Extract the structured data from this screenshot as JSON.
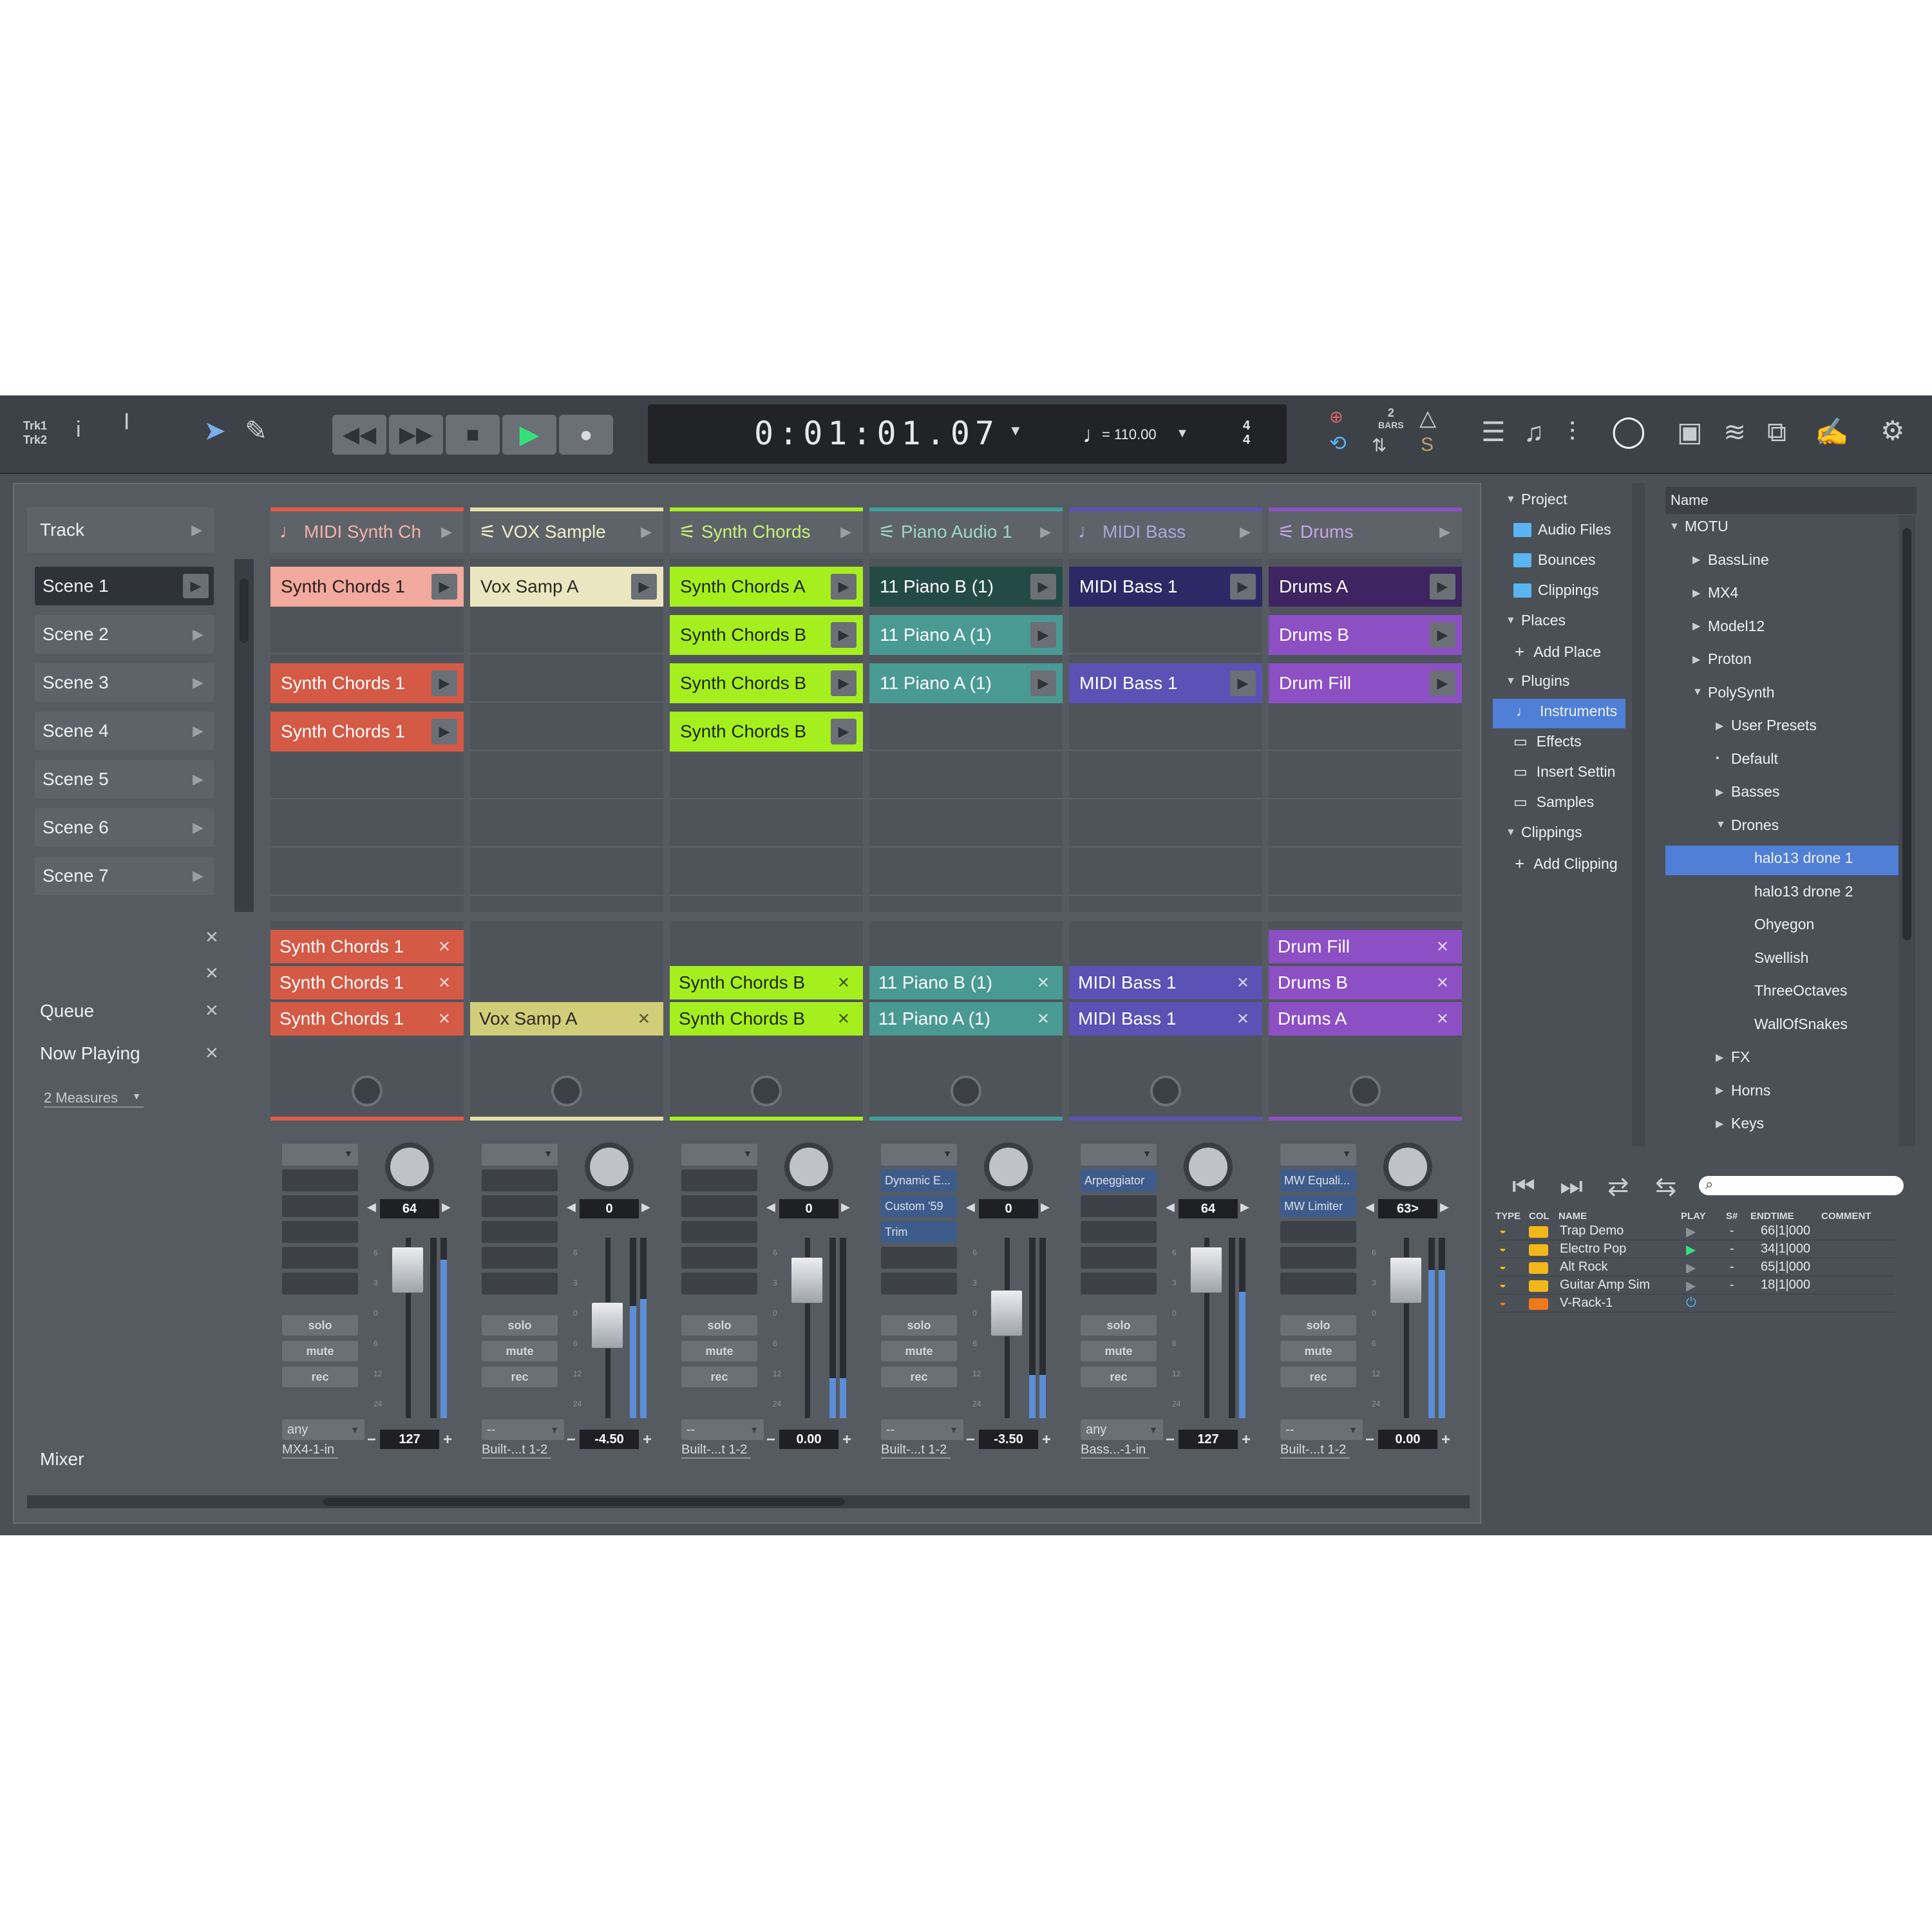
{
  "toolbar": {
    "trk_label": "Trk1\nTrk2",
    "counter_time": "0:01:01.07",
    "tempo": "110.00",
    "meter_top": "4",
    "meter_bottom": "4",
    "bars_count": "2",
    "bars_label": "BARS"
  },
  "sidebar": {
    "track_label": "Track",
    "scenes": [
      "Scene 1",
      "Scene 2",
      "Scene 3",
      "Scene 4",
      "Scene 5",
      "Scene 6",
      "Scene 7"
    ],
    "queue_label": "Queue",
    "now_playing_label": "Now Playing",
    "measures": "2 Measures",
    "mixer_label": "Mixer"
  },
  "tracks": [
    {
      "name": "MIDI Synth Ch",
      "color": "#e35a48",
      "header_text_color": "#f5b3a6",
      "icon": "♩",
      "clips": [
        {
          "row": 0,
          "label": "Synth Chords 1",
          "bg": "#f2a99e",
          "fg": "#2a1d1b"
        },
        {
          "row": 2,
          "label": "Synth Chords 1",
          "bg": "#d45a46",
          "fg": "#ffffff"
        },
        {
          "row": 3,
          "label": "Synth Chords 1",
          "bg": "#d45a46",
          "fg": "#ffffff"
        }
      ],
      "queue": [
        {
          "row": 0,
          "label": "Synth Chords 1"
        },
        {
          "row": 1,
          "label": "Synth Chords 1"
        },
        {
          "row": 2,
          "label": "Synth Chords 1"
        }
      ],
      "queue_bg": "#d45a46",
      "queue_fg": "#ffffff",
      "mixer": {
        "inserts": [],
        "knob": "64",
        "fader": "127",
        "fader_pos": 0.12,
        "meter_l": 0,
        "meter_r": 0.88,
        "input": "any",
        "output": "MX4-1-in"
      }
    },
    {
      "name": "VOX Sample",
      "color": "#e4e0a4",
      "header_text_color": "#f2efc8",
      "icon": "⚟",
      "clips": [
        {
          "row": 0,
          "label": "Vox Samp A",
          "bg": "#eae7c0",
          "fg": "#2a2a22"
        }
      ],
      "queue": [
        {
          "row": 2,
          "label": "Vox Samp A"
        }
      ],
      "queue_bg": "#d1cd79",
      "queue_fg": "#2a2a22",
      "mixer": {
        "inserts": [],
        "knob": "0",
        "fader": "-4.50",
        "fader_pos": 0.43,
        "meter_l": 0.62,
        "meter_r": 0.66,
        "input": "--",
        "output": "Built-...t 1-2"
      }
    },
    {
      "name": "Synth Chords",
      "color": "#a6ef1f",
      "header_text_color": "#c8f27a",
      "icon": "⚟",
      "clips": [
        {
          "row": 0,
          "label": "Synth Chords A",
          "bg": "#a6ef1f",
          "fg": "#1a2608"
        },
        {
          "row": 1,
          "label": "Synth Chords B",
          "bg": "#a6ef1f",
          "fg": "#1a2608"
        },
        {
          "row": 2,
          "label": "Synth Chords B",
          "bg": "#a6ef1f",
          "fg": "#1a2608"
        },
        {
          "row": 3,
          "label": "Synth Chords B",
          "bg": "#a6ef1f",
          "fg": "#1a2608"
        }
      ],
      "queue": [
        {
          "row": 1,
          "label": "Synth Chords B"
        },
        {
          "row": 2,
          "label": "Synth Chords B"
        }
      ],
      "queue_bg": "#a6ef1f",
      "queue_fg": "#1a2608",
      "mixer": {
        "inserts": [],
        "knob": "0",
        "fader": "0.00",
        "fader_pos": 0.18,
        "meter_l": 0.22,
        "meter_r": 0.22,
        "input": "--",
        "output": "Built-...t 1-2"
      }
    },
    {
      "name": "Piano Audio 1",
      "color": "#3fa09a",
      "header_text_color": "#9fd4d0",
      "icon": "⚟",
      "clips": [
        {
          "row": 0,
          "label": "11 Piano B (1)",
          "bg": "#244a48",
          "fg": "#ffffff"
        },
        {
          "row": 1,
          "label": "11 Piano A (1)",
          "bg": "#4a9a94",
          "fg": "#ffffff"
        },
        {
          "row": 2,
          "label": "11 Piano A (1)",
          "bg": "#4a9a94",
          "fg": "#ffffff"
        }
      ],
      "queue": [
        {
          "row": 1,
          "label": "11 Piano B (1)"
        },
        {
          "row": 2,
          "label": "11 Piano A (1)"
        }
      ],
      "queue_bg": "#4a9a94",
      "queue_fg": "#ffffff",
      "mixer": {
        "inserts": [
          "Dynamic E...",
          "Custom '59",
          "Trim"
        ],
        "knob": "0",
        "fader": "-3.50",
        "fader_pos": 0.36,
        "meter_l": 0.24,
        "meter_r": 0.24,
        "input": "--",
        "output": "Built-...t 1-2"
      }
    },
    {
      "name": "MIDI Bass",
      "color": "#5a52b5",
      "header_text_color": "#aaa6dd",
      "icon": "♩",
      "clips": [
        {
          "row": 0,
          "label": "MIDI Bass 1",
          "bg": "#2c2a66",
          "fg": "#ffffff"
        },
        {
          "row": 2,
          "label": "MIDI Bass 1",
          "bg": "#5a52b5",
          "fg": "#ffffff"
        }
      ],
      "queue": [
        {
          "row": 1,
          "label": "MIDI Bass 1"
        },
        {
          "row": 2,
          "label": "MIDI Bass 1"
        }
      ],
      "queue_bg": "#5a52b5",
      "queue_fg": "#ffffff",
      "mixer": {
        "inserts": [
          "Arpeggiator"
        ],
        "knob": "64",
        "fader": "127",
        "fader_pos": 0.12,
        "meter_l": 0,
        "meter_r": 0.7,
        "input": "any",
        "output": "Bass...-1-in"
      }
    },
    {
      "name": "Drums",
      "color": "#8c4fc4",
      "header_text_color": "#c6a6e6",
      "icon": "⚟",
      "clips": [
        {
          "row": 0,
          "label": "Drums A",
          "bg": "#3e2460",
          "fg": "#ffffff"
        },
        {
          "row": 1,
          "label": "Drums B",
          "bg": "#8c4fc4",
          "fg": "#ffffff"
        },
        {
          "row": 2,
          "label": "Drum Fill",
          "bg": "#8c4fc4",
          "fg": "#ffffff"
        }
      ],
      "queue": [
        {
          "row": 0,
          "label": "Drum Fill"
        },
        {
          "row": 1,
          "label": "Drums B"
        },
        {
          "row": 2,
          "label": "Drums A"
        }
      ],
      "queue_bg": "#8c4fc4",
      "queue_fg": "#ffffff",
      "mixer": {
        "inserts": [
          "MW Equali...",
          "MW Limiter"
        ],
        "knob": "63>",
        "fader": "0.00",
        "fader_pos": 0.18,
        "meter_l": 0.82,
        "meter_r": 0.82,
        "input": "--",
        "output": "Built-...t 1-2"
      }
    }
  ],
  "mixer_labels": {
    "solo": "solo",
    "mute": "mute",
    "rec": "rec"
  },
  "browser": {
    "left_tree": [
      {
        "label": "Project",
        "type": "expander"
      },
      {
        "label": "Audio Files",
        "type": "folder"
      },
      {
        "label": "Bounces",
        "type": "folder"
      },
      {
        "label": "Clippings",
        "type": "folder"
      },
      {
        "label": "Places",
        "type": "expander"
      },
      {
        "label": "Add Place",
        "type": "add"
      },
      {
        "label": "Plugins",
        "type": "expander"
      },
      {
        "label": "Instruments",
        "type": "selected"
      },
      {
        "label": "Effects",
        "type": "item"
      },
      {
        "label": "Insert Settin",
        "type": "item"
      },
      {
        "label": "Samples",
        "type": "item"
      },
      {
        "label": "Clippings",
        "type": "expander"
      },
      {
        "label": "Add Clipping",
        "type": "add"
      }
    ],
    "right_header": "Name",
    "right_tree": [
      {
        "label": "MOTU",
        "indent": 0,
        "tw": "▼"
      },
      {
        "label": "BassLine",
        "indent": 1,
        "tw": "▶"
      },
      {
        "label": "MX4",
        "indent": 1,
        "tw": "▶"
      },
      {
        "label": "Model12",
        "indent": 1,
        "tw": "▶"
      },
      {
        "label": "Proton",
        "indent": 1,
        "tw": "▶"
      },
      {
        "label": "PolySynth",
        "indent": 1,
        "tw": "▼"
      },
      {
        "label": "User Presets",
        "indent": 2,
        "tw": "▶"
      },
      {
        "label": "Default",
        "indent": 2,
        "tw": "•"
      },
      {
        "label": "Basses",
        "indent": 2,
        "tw": "▶"
      },
      {
        "label": "Drones",
        "indent": 2,
        "tw": "▼"
      },
      {
        "label": "halo13 drone 1",
        "indent": 3,
        "tw": "",
        "selected": true
      },
      {
        "label": "halo13 drone 2",
        "indent": 3,
        "tw": ""
      },
      {
        "label": "Ohyegon",
        "indent": 3,
        "tw": ""
      },
      {
        "label": "Swellish",
        "indent": 3,
        "tw": ""
      },
      {
        "label": "ThreeOctaves",
        "indent": 3,
        "tw": ""
      },
      {
        "label": "WallOfSnakes",
        "indent": 3,
        "tw": ""
      },
      {
        "label": "FX",
        "indent": 2,
        "tw": "▶"
      },
      {
        "label": "Horns",
        "indent": 2,
        "tw": "▶"
      },
      {
        "label": "Keys",
        "indent": 2,
        "tw": "▶"
      }
    ]
  },
  "chunks": {
    "headers": [
      "TYPE",
      "COL",
      "NAME",
      "PLAY",
      "S#",
      "ENDTIME",
      "COMMENT"
    ],
    "rows": [
      {
        "name": "Trap Demo",
        "play": "▶",
        "snum": "-",
        "endtime": "66|1|000",
        "col": "#f2b81a",
        "playing": false
      },
      {
        "name": "Electro Pop",
        "play": "▶",
        "snum": "-",
        "endtime": "34|1|000",
        "col": "#f2b81a",
        "playing": true
      },
      {
        "name": "Alt Rock",
        "play": "▶",
        "snum": "-",
        "endtime": "65|1|000",
        "col": "#f2b81a",
        "playing": false
      },
      {
        "name": "Guitar Amp Sim",
        "play": "▶",
        "snum": "-",
        "endtime": "18|1|000",
        "col": "#f2b81a",
        "playing": false
      },
      {
        "name": "V-Rack-1",
        "play": "⏻",
        "snum": "",
        "endtime": "",
        "col": "#f07a1a",
        "playing": false
      }
    ]
  },
  "colors": {
    "accent": "#4f7fd6",
    "play_green": "#35e07a",
    "meter_blue": "#5b8ed6"
  }
}
